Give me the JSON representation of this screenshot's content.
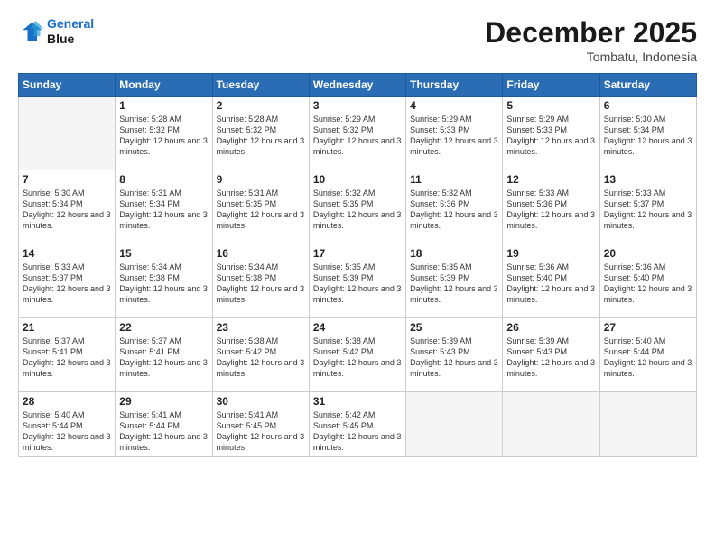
{
  "logo": {
    "line1": "General",
    "line2": "Blue"
  },
  "title": "December 2025",
  "location": "Tombatu, Indonesia",
  "days_header": [
    "Sunday",
    "Monday",
    "Tuesday",
    "Wednesday",
    "Thursday",
    "Friday",
    "Saturday"
  ],
  "weeks": [
    [
      {
        "num": "",
        "empty": true
      },
      {
        "num": "1",
        "sunrise": "5:28 AM",
        "sunset": "5:32 PM",
        "daylight": "12 hours and 3 minutes."
      },
      {
        "num": "2",
        "sunrise": "5:28 AM",
        "sunset": "5:32 PM",
        "daylight": "12 hours and 3 minutes."
      },
      {
        "num": "3",
        "sunrise": "5:29 AM",
        "sunset": "5:32 PM",
        "daylight": "12 hours and 3 minutes."
      },
      {
        "num": "4",
        "sunrise": "5:29 AM",
        "sunset": "5:33 PM",
        "daylight": "12 hours and 3 minutes."
      },
      {
        "num": "5",
        "sunrise": "5:29 AM",
        "sunset": "5:33 PM",
        "daylight": "12 hours and 3 minutes."
      },
      {
        "num": "6",
        "sunrise": "5:30 AM",
        "sunset": "5:34 PM",
        "daylight": "12 hours and 3 minutes."
      }
    ],
    [
      {
        "num": "7",
        "sunrise": "5:30 AM",
        "sunset": "5:34 PM",
        "daylight": "12 hours and 3 minutes."
      },
      {
        "num": "8",
        "sunrise": "5:31 AM",
        "sunset": "5:34 PM",
        "daylight": "12 hours and 3 minutes."
      },
      {
        "num": "9",
        "sunrise": "5:31 AM",
        "sunset": "5:35 PM",
        "daylight": "12 hours and 3 minutes."
      },
      {
        "num": "10",
        "sunrise": "5:32 AM",
        "sunset": "5:35 PM",
        "daylight": "12 hours and 3 minutes."
      },
      {
        "num": "11",
        "sunrise": "5:32 AM",
        "sunset": "5:36 PM",
        "daylight": "12 hours and 3 minutes."
      },
      {
        "num": "12",
        "sunrise": "5:33 AM",
        "sunset": "5:36 PM",
        "daylight": "12 hours and 3 minutes."
      },
      {
        "num": "13",
        "sunrise": "5:33 AM",
        "sunset": "5:37 PM",
        "daylight": "12 hours and 3 minutes."
      }
    ],
    [
      {
        "num": "14",
        "sunrise": "5:33 AM",
        "sunset": "5:37 PM",
        "daylight": "12 hours and 3 minutes."
      },
      {
        "num": "15",
        "sunrise": "5:34 AM",
        "sunset": "5:38 PM",
        "daylight": "12 hours and 3 minutes."
      },
      {
        "num": "16",
        "sunrise": "5:34 AM",
        "sunset": "5:38 PM",
        "daylight": "12 hours and 3 minutes."
      },
      {
        "num": "17",
        "sunrise": "5:35 AM",
        "sunset": "5:39 PM",
        "daylight": "12 hours and 3 minutes."
      },
      {
        "num": "18",
        "sunrise": "5:35 AM",
        "sunset": "5:39 PM",
        "daylight": "12 hours and 3 minutes."
      },
      {
        "num": "19",
        "sunrise": "5:36 AM",
        "sunset": "5:40 PM",
        "daylight": "12 hours and 3 minutes."
      },
      {
        "num": "20",
        "sunrise": "5:36 AM",
        "sunset": "5:40 PM",
        "daylight": "12 hours and 3 minutes."
      }
    ],
    [
      {
        "num": "21",
        "sunrise": "5:37 AM",
        "sunset": "5:41 PM",
        "daylight": "12 hours and 3 minutes."
      },
      {
        "num": "22",
        "sunrise": "5:37 AM",
        "sunset": "5:41 PM",
        "daylight": "12 hours and 3 minutes."
      },
      {
        "num": "23",
        "sunrise": "5:38 AM",
        "sunset": "5:42 PM",
        "daylight": "12 hours and 3 minutes."
      },
      {
        "num": "24",
        "sunrise": "5:38 AM",
        "sunset": "5:42 PM",
        "daylight": "12 hours and 3 minutes."
      },
      {
        "num": "25",
        "sunrise": "5:39 AM",
        "sunset": "5:43 PM",
        "daylight": "12 hours and 3 minutes."
      },
      {
        "num": "26",
        "sunrise": "5:39 AM",
        "sunset": "5:43 PM",
        "daylight": "12 hours and 3 minutes."
      },
      {
        "num": "27",
        "sunrise": "5:40 AM",
        "sunset": "5:44 PM",
        "daylight": "12 hours and 3 minutes."
      }
    ],
    [
      {
        "num": "28",
        "sunrise": "5:40 AM",
        "sunset": "5:44 PM",
        "daylight": "12 hours and 3 minutes."
      },
      {
        "num": "29",
        "sunrise": "5:41 AM",
        "sunset": "5:44 PM",
        "daylight": "12 hours and 3 minutes."
      },
      {
        "num": "30",
        "sunrise": "5:41 AM",
        "sunset": "5:45 PM",
        "daylight": "12 hours and 3 minutes."
      },
      {
        "num": "31",
        "sunrise": "5:42 AM",
        "sunset": "5:45 PM",
        "daylight": "12 hours and 3 minutes."
      },
      {
        "num": "",
        "empty": true
      },
      {
        "num": "",
        "empty": true
      },
      {
        "num": "",
        "empty": true
      }
    ]
  ]
}
